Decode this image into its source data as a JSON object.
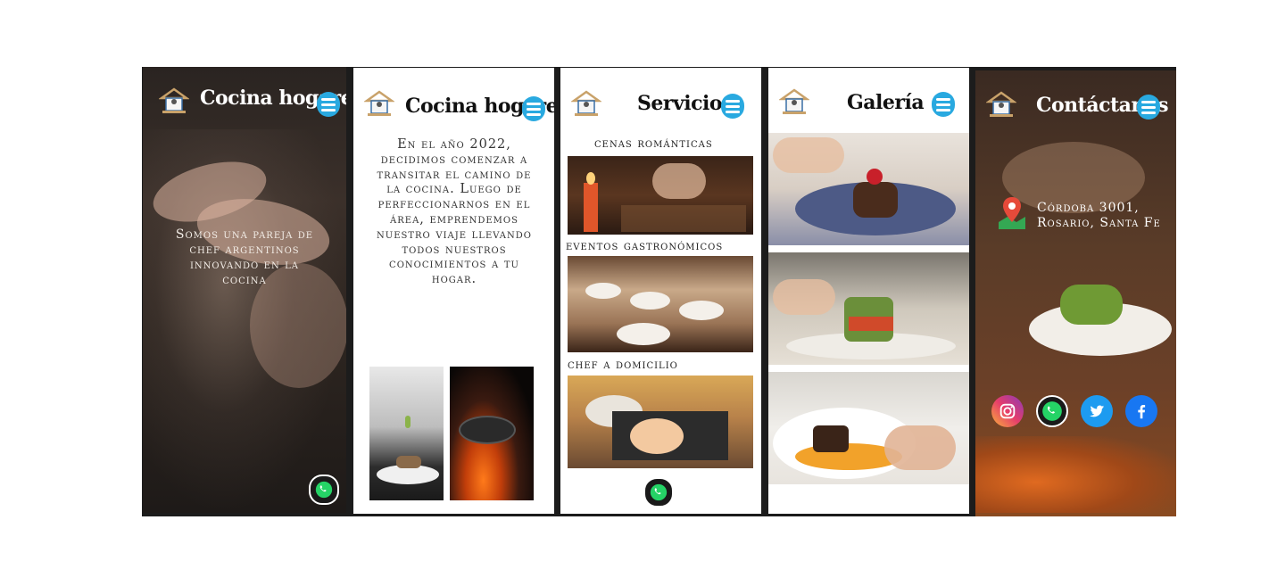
{
  "screens": {
    "inicio": {
      "title": "Cocina hogareña",
      "tagline": "Somos una pareja de chef argentinos innovando en la cocina"
    },
    "nosotros": {
      "title": "Cocina hogareña",
      "text": "En el año 2022, decidimos comenzar a transitar el camino de la cocina. Luego de perfeccionarnos en el área, emprendemos nuestro viaje llevando todos nuestros conocimientos a tu hogar."
    },
    "servicios": {
      "title": "Servicios",
      "items": [
        "cenas románticas",
        "eventos gastronómicos",
        "chef a domicilio"
      ]
    },
    "galeria": {
      "title": "Galería"
    },
    "contacto": {
      "title": "Contáctanos",
      "address": "Córdoba 3001, Rosario, Santa Fe",
      "socials": [
        "instagram-icon",
        "whatsapp-icon",
        "twitter-icon",
        "facebook-icon"
      ]
    }
  },
  "colors": {
    "menu_button": "#29a9e0",
    "whatsapp": "#25d366",
    "twitter": "#1d9bf0",
    "facebook": "#1877f2",
    "location_pin": "#e64a3a"
  }
}
